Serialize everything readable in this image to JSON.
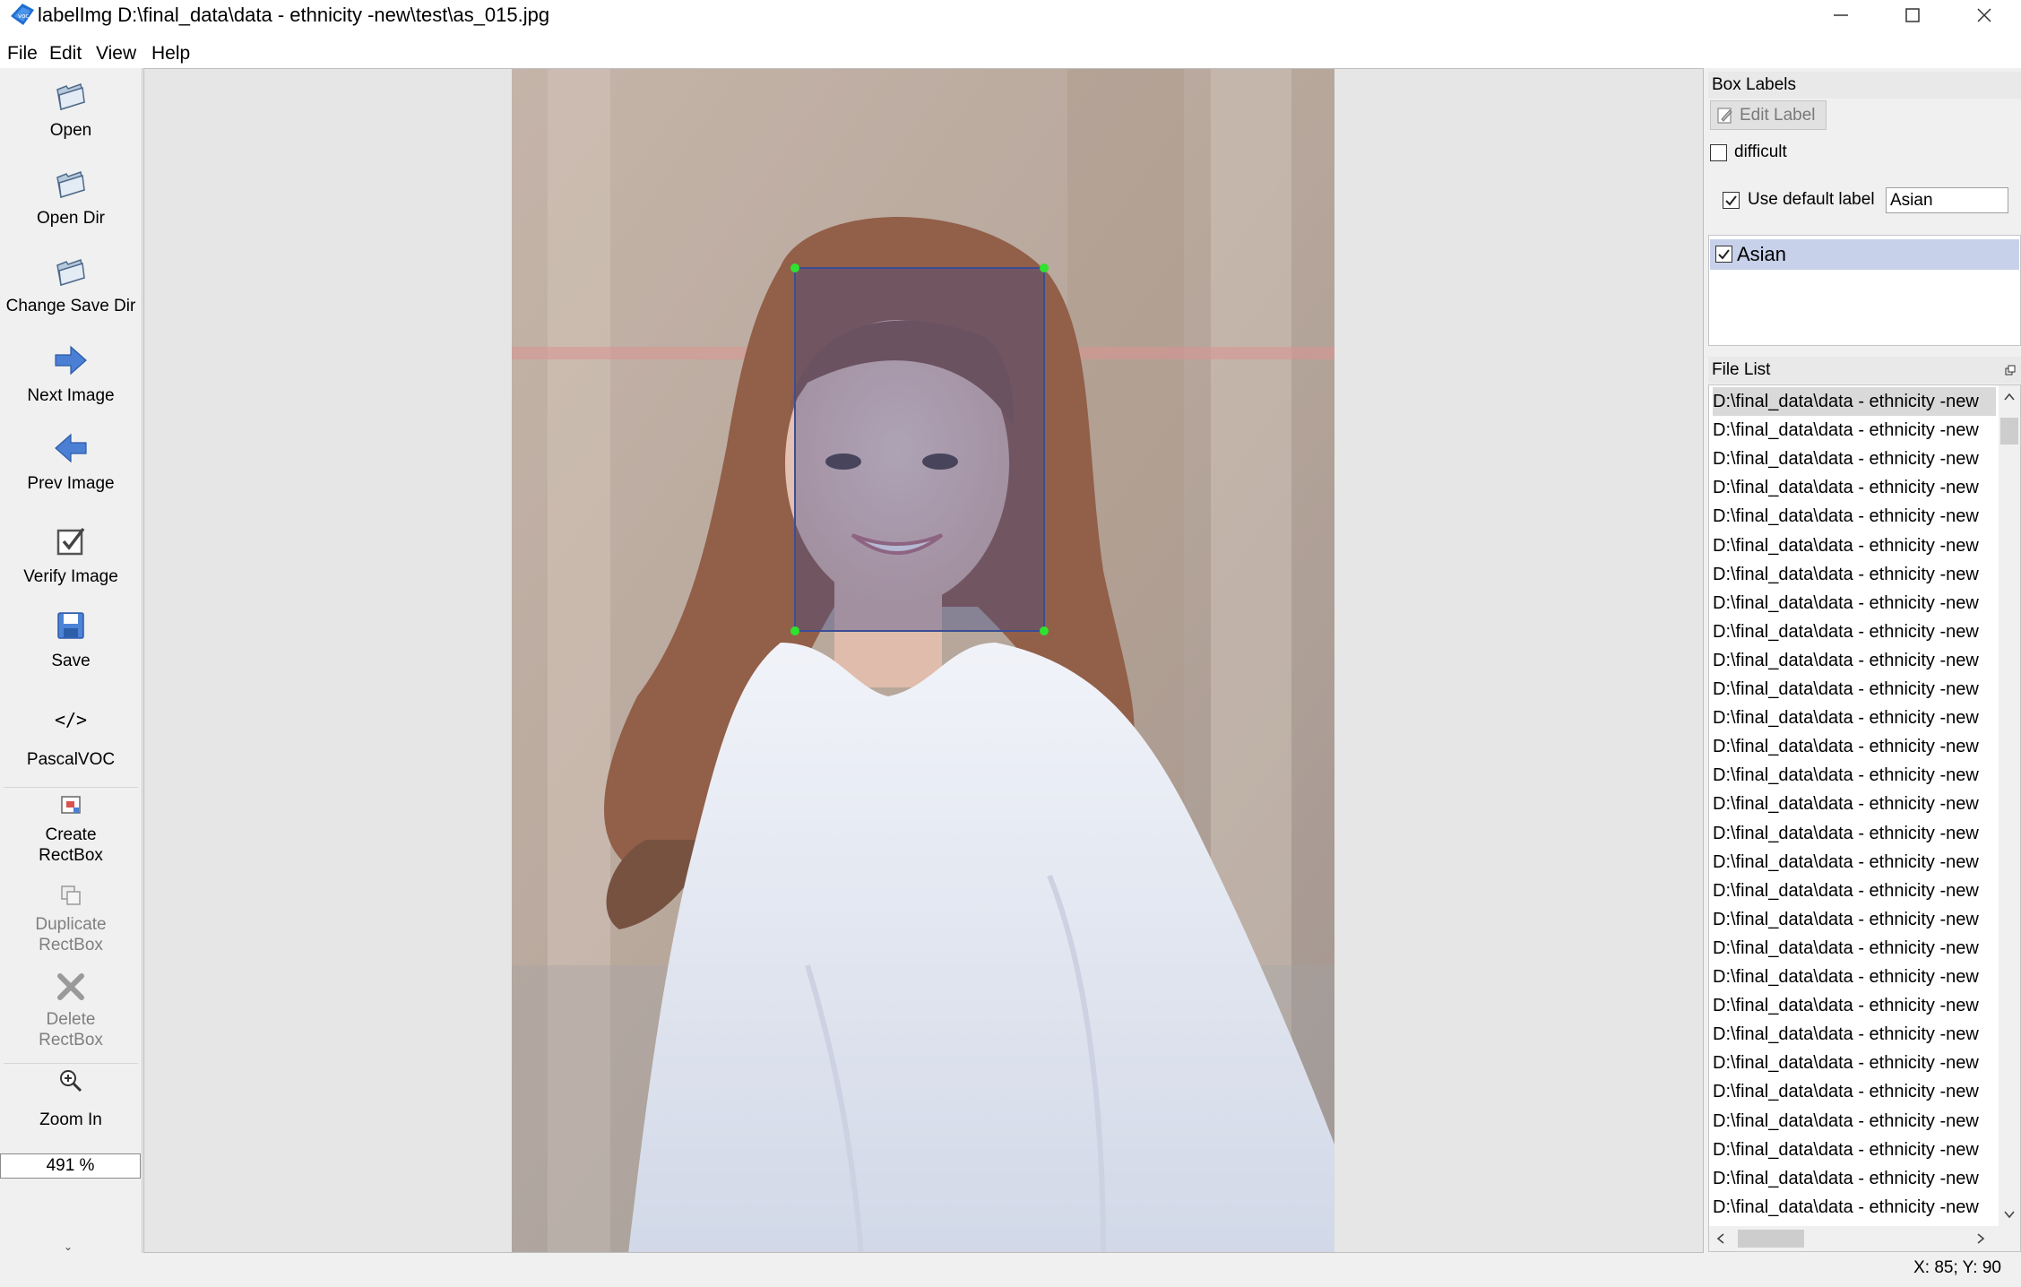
{
  "window": {
    "title": "labelImg D:\\final_data\\data - ethnicity -new\\test\\as_015.jpg",
    "app_icon": "labelimg-icon"
  },
  "menu": [
    "File",
    "Edit",
    "View",
    "Help"
  ],
  "toolbar": {
    "open": "Open",
    "open_dir": "Open Dir",
    "change_save_dir": "Change Save Dir",
    "next_image": "Next Image",
    "prev_image": "Prev Image",
    "verify_image": "Verify Image",
    "save": "Save",
    "format_icon": "</>",
    "format": "PascalVOC",
    "create_rectbox": "Create\nRectBox",
    "duplicate_rectbox": "Duplicate\nRectBox",
    "delete_rectbox": "Delete\nRectBox",
    "zoom_in": "Zoom In",
    "zoom_value": "491 %"
  },
  "box_labels": {
    "title": "Box Labels",
    "edit_label_button": "Edit Label",
    "difficult_label": "difficult",
    "difficult_checked": false,
    "use_default_label": "Use default label",
    "use_default_checked": true,
    "default_label_value": "Asian",
    "labels": [
      {
        "text": "Asian",
        "checked": true
      }
    ]
  },
  "file_list": {
    "title": "File List",
    "items": [
      "D:\\final_data\\data - ethnicity -new",
      "D:\\final_data\\data - ethnicity -new",
      "D:\\final_data\\data - ethnicity -new",
      "D:\\final_data\\data - ethnicity -new",
      "D:\\final_data\\data - ethnicity -new",
      "D:\\final_data\\data - ethnicity -new",
      "D:\\final_data\\data - ethnicity -new",
      "D:\\final_data\\data - ethnicity -new",
      "D:\\final_data\\data - ethnicity -new",
      "D:\\final_data\\data - ethnicity -new",
      "D:\\final_data\\data - ethnicity -new",
      "D:\\final_data\\data - ethnicity -new",
      "D:\\final_data\\data - ethnicity -new",
      "D:\\final_data\\data - ethnicity -new",
      "D:\\final_data\\data - ethnicity -new",
      "D:\\final_data\\data - ethnicity -new",
      "D:\\final_data\\data - ethnicity -new",
      "D:\\final_data\\data - ethnicity -new",
      "D:\\final_data\\data - ethnicity -new",
      "D:\\final_data\\data - ethnicity -new",
      "D:\\final_data\\data - ethnicity -new",
      "D:\\final_data\\data - ethnicity -new",
      "D:\\final_data\\data - ethnicity -new",
      "D:\\final_data\\data - ethnicity -new",
      "D:\\final_data\\data - ethnicity -new",
      "D:\\final_data\\data - ethnicity -new",
      "D:\\final_data\\data - ethnicity -new",
      "D:\\final_data\\data - ethnicity -new",
      "D:\\final_data\\data - ethnicity -new"
    ]
  },
  "status_bar": {
    "coords": "X: 85; Y: 90"
  },
  "colors": {
    "bbox_fill": "#3c468c",
    "bbox_handle": "#2ee32e",
    "selected_label_bg": "#c7d1ea"
  }
}
